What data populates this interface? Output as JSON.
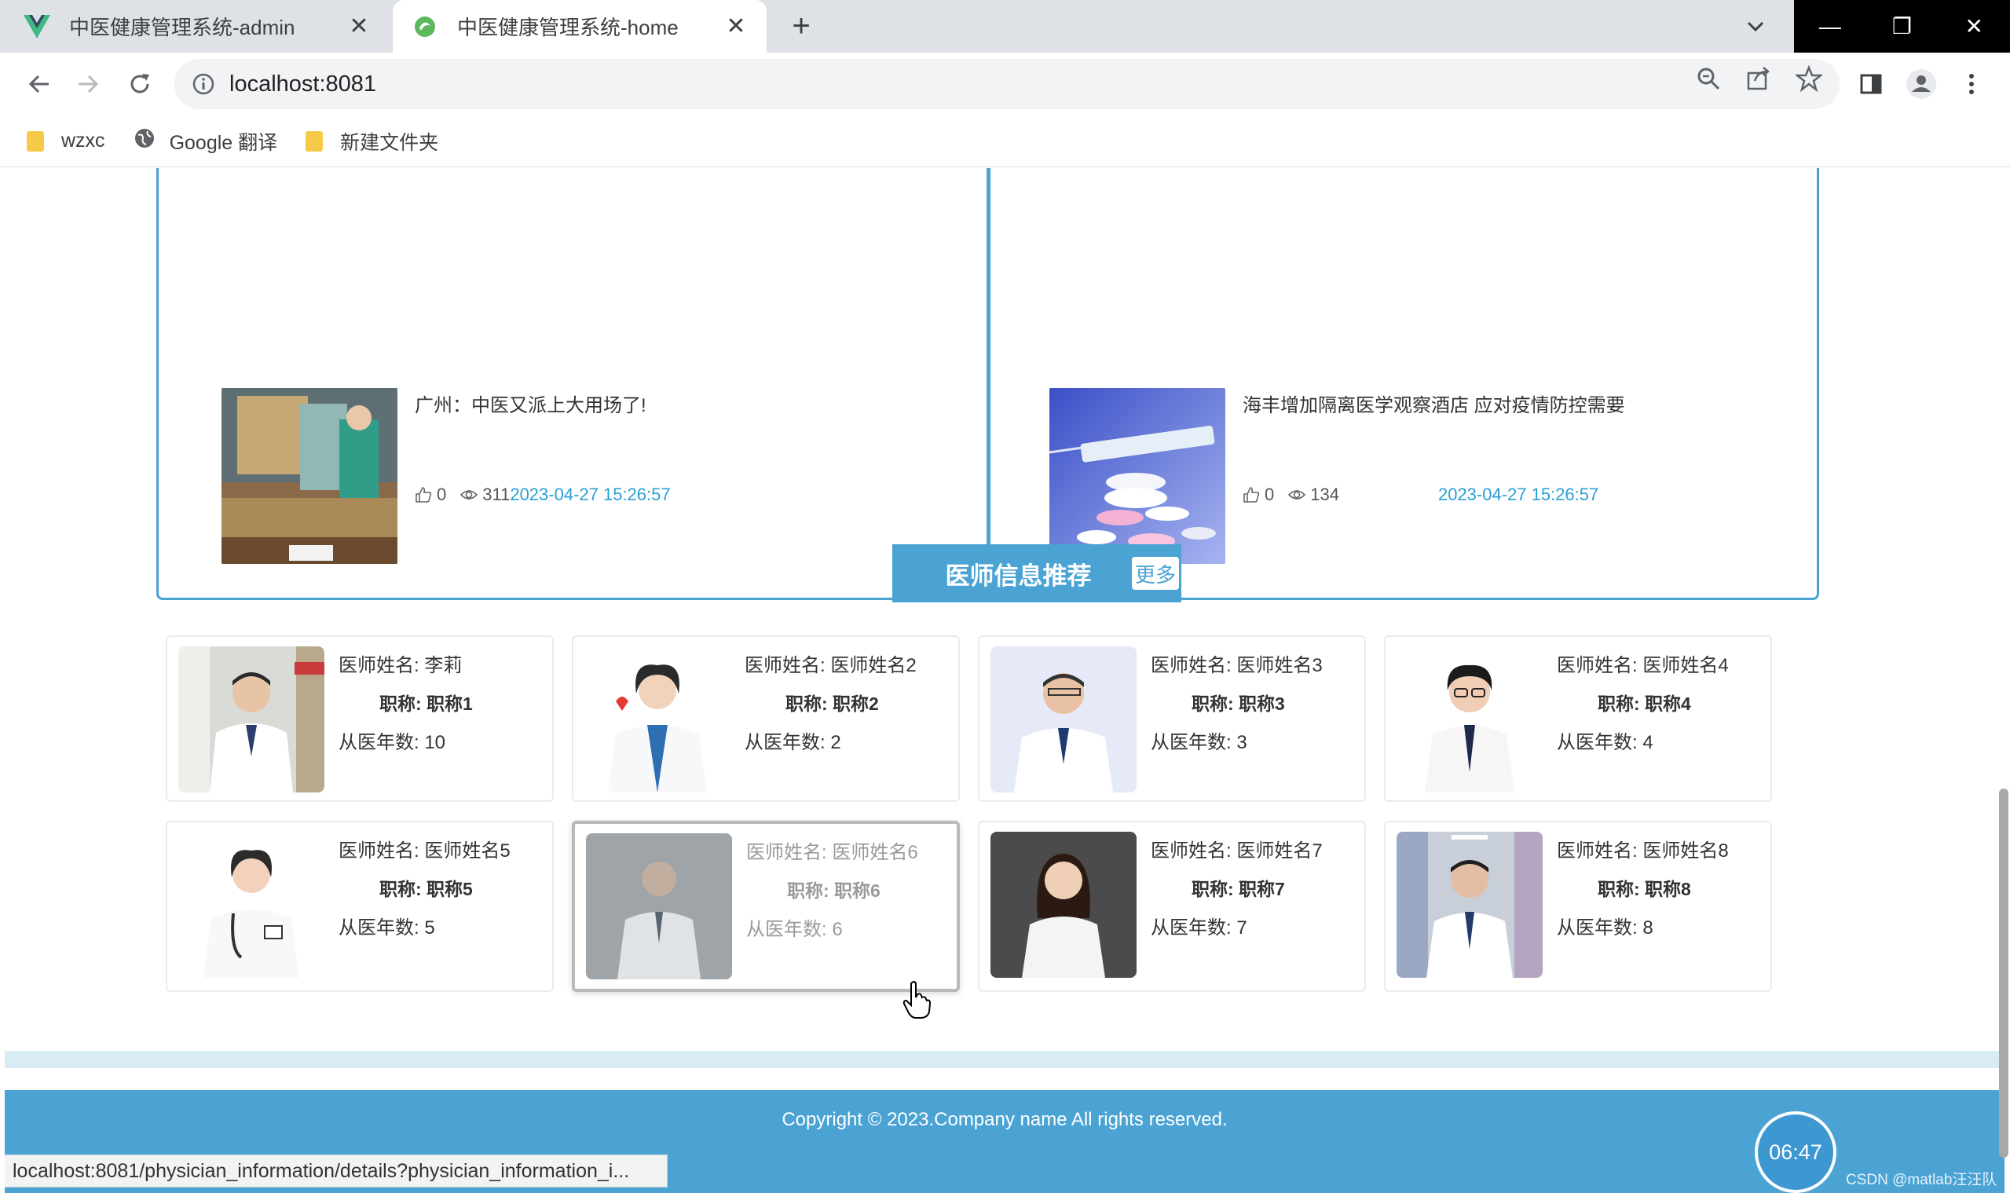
{
  "browser": {
    "tabs": [
      {
        "title": "中医健康管理系统-admin",
        "icon": "vue-icon",
        "active": false
      },
      {
        "title": "中医健康管理系统-home",
        "icon": "page-icon",
        "active": true
      }
    ],
    "url": "localhost:8081",
    "bookmarks": [
      {
        "label": "wzxc",
        "icon": "folder-icon"
      },
      {
        "label": "Google 翻译",
        "icon": "globe-icon"
      },
      {
        "label": "新建文件夹",
        "icon": "folder-icon"
      }
    ]
  },
  "news": [
    {
      "title": "广州：中医又派上大用场了!",
      "likes": "0",
      "views": "311",
      "date": "2023-04-27 15:26:57"
    },
    {
      "title": "海丰增加隔离医学观察酒店 应对疫情防控需要",
      "likes": "0",
      "views": "134",
      "date": "2023-04-27 15:26:57"
    }
  ],
  "physicians": {
    "title": "医师信息推荐",
    "more_label": "更多",
    "cards": [
      {
        "name": "医师姓名: 李莉",
        "title": "职称: 职称1",
        "years": "从医年数: 10"
      },
      {
        "name": "医师姓名: 医师姓名2",
        "title": "职称: 职称2",
        "years": "从医年数: 2"
      },
      {
        "name": "医师姓名: 医师姓名3",
        "title": "职称: 职称3",
        "years": "从医年数: 3"
      },
      {
        "name": "医师姓名: 医师姓名4",
        "title": "职称: 职称4",
        "years": "从医年数: 4"
      },
      {
        "name": "医师姓名: 医师姓名5",
        "title": "职称: 职称5",
        "years": "从医年数: 5"
      },
      {
        "name": "医师姓名: 医师姓名6",
        "title": "职称: 职称6",
        "years": "从医年数: 6"
      },
      {
        "name": "医师姓名: 医师姓名7",
        "title": "职称: 职称7",
        "years": "从医年数: 7"
      },
      {
        "name": "医师姓名: 医师姓名8",
        "title": "职称: 职称8",
        "years": "从医年数: 8"
      }
    ]
  },
  "footer": {
    "copyright": "Copyright © 2023.Company name All rights reserved."
  },
  "status_url": "localhost:8081/physician_information/details?physician_information_i...",
  "timer": "06:47",
  "watermark": "CSDN @matlab汪汪队",
  "colors": {
    "accent": "#4aa3d3",
    "date": "#2a9fd6"
  }
}
